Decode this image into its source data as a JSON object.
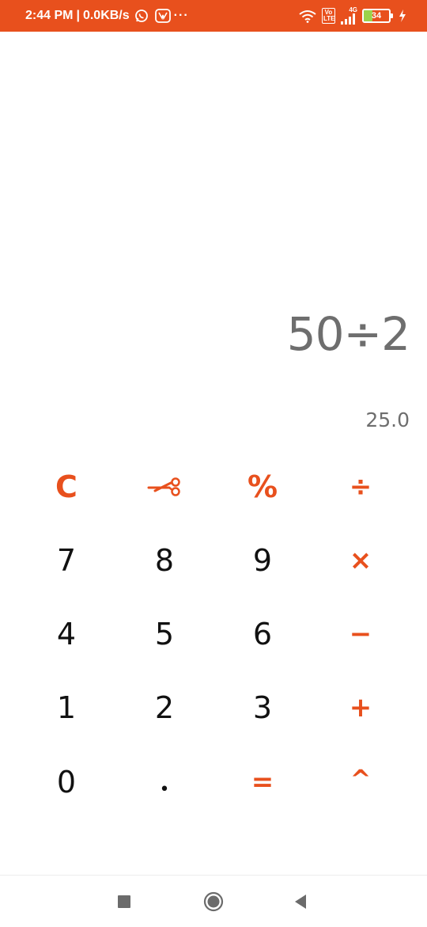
{
  "status_bar": {
    "time": "2:44 PM",
    "separator": "|",
    "network_speed": "0.0KB/s",
    "overflow_indicator": "···",
    "network_type": "4G",
    "volte_label_top": "Vo",
    "volte_label_bottom": "LTE",
    "battery_level": "34",
    "background_color": "#e8501d"
  },
  "display": {
    "expression": "50÷2",
    "result": "25.0"
  },
  "keypad": {
    "rows": [
      [
        {
          "label": "C",
          "type": "op",
          "name": "clear-button"
        },
        {
          "label": "",
          "type": "op",
          "name": "backspace-button",
          "icon": "scissors-icon"
        },
        {
          "label": "%",
          "type": "op",
          "name": "percent-button"
        },
        {
          "label": "÷",
          "type": "op",
          "name": "divide-button"
        }
      ],
      [
        {
          "label": "7",
          "type": "num",
          "name": "digit-7-button"
        },
        {
          "label": "8",
          "type": "num",
          "name": "digit-8-button"
        },
        {
          "label": "9",
          "type": "num",
          "name": "digit-9-button"
        },
        {
          "label": "×",
          "type": "op",
          "name": "multiply-button"
        }
      ],
      [
        {
          "label": "4",
          "type": "num",
          "name": "digit-4-button"
        },
        {
          "label": "5",
          "type": "num",
          "name": "digit-5-button"
        },
        {
          "label": "6",
          "type": "num",
          "name": "digit-6-button"
        },
        {
          "label": "−",
          "type": "op",
          "name": "subtract-button"
        }
      ],
      [
        {
          "label": "1",
          "type": "num",
          "name": "digit-1-button"
        },
        {
          "label": "2",
          "type": "num",
          "name": "digit-2-button"
        },
        {
          "label": "3",
          "type": "num",
          "name": "digit-3-button"
        },
        {
          "label": "+",
          "type": "op",
          "name": "add-button"
        }
      ],
      [
        {
          "label": "0",
          "type": "num",
          "name": "digit-0-button"
        },
        {
          "label": "•",
          "type": "num",
          "name": "decimal-point-button"
        },
        {
          "label": "=",
          "type": "op",
          "name": "equals-button"
        },
        {
          "label": "^",
          "type": "op",
          "name": "power-button"
        }
      ]
    ],
    "accent_color": "#e8501d",
    "digit_color": "#111111"
  },
  "nav_bar": {
    "recents_icon": "square-icon",
    "home_icon": "circle-icon",
    "back_icon": "triangle-back-icon"
  }
}
